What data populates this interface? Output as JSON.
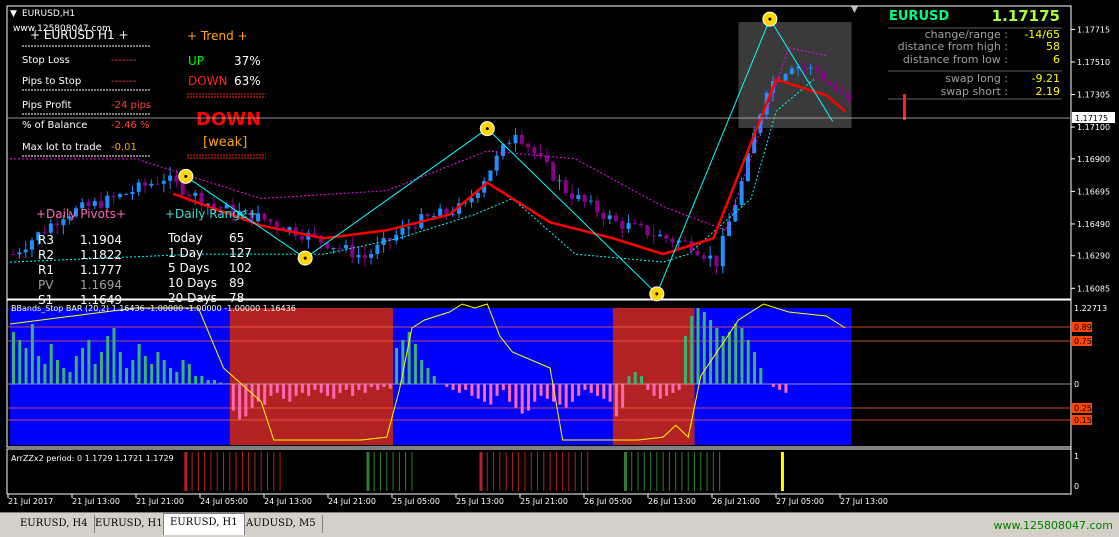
{
  "window": {
    "title": "EURUSD,H1",
    "site": "www.125808047.com"
  },
  "watermark": "www.125808047.com",
  "tabs": [
    {
      "label": "EURUSD, H4",
      "active": false
    },
    {
      "label": "EURUSD, H1",
      "active": false
    },
    {
      "label": "EURUSD, H1",
      "active": true
    },
    {
      "label": "AUDUSD, M5",
      "active": false
    }
  ],
  "info_panel": {
    "header": "+   EURUSD  H1   +",
    "rows": [
      {
        "label": "Stop Loss",
        "value": "-------",
        "color": "#ff4040"
      },
      {
        "label": "Pips to Stop",
        "value": "-------",
        "color": "#ff4040"
      },
      {
        "label": "Pips Profit",
        "value": "-24 pips",
        "color": "#ff4040"
      },
      {
        "label": "% of Balance",
        "value": "-2.46 %",
        "color": "#ff4040"
      },
      {
        "label": "Max lot to trade",
        "value": "-0.01",
        "color": "#ffa500"
      }
    ]
  },
  "trend_panel": {
    "header": "+   Trend   +",
    "up_label": "UP",
    "up_value": "37%",
    "down_label": "DOWN",
    "down_value": "63%",
    "signal": "DOWN",
    "strength": "[weak]"
  },
  "pivots": {
    "header": "+Daily Pivots+",
    "rows": [
      {
        "label": "R3",
        "value": "1.1904"
      },
      {
        "label": "R2",
        "value": "1.1822"
      },
      {
        "label": "R1",
        "value": "1.1777"
      },
      {
        "label": "PV",
        "value": "1.1694"
      },
      {
        "label": "S1",
        "value": "1.1649"
      }
    ]
  },
  "ranges": {
    "header": "+Daily Range+",
    "rows": [
      {
        "label": "Today",
        "value": "65"
      },
      {
        "label": "1 Day",
        "value": "127"
      },
      {
        "label": "5 Days",
        "value": "102"
      },
      {
        "label": "10 Days",
        "value": "89"
      },
      {
        "label": "20 Days",
        "value": "78"
      }
    ]
  },
  "quote_panel": {
    "symbol": "EURUSD",
    "price": "1.17175",
    "rows": [
      {
        "label": "change/range :",
        "value": "-14/65",
        "color": "#ffff00"
      },
      {
        "label": "distance from high :",
        "value": "58",
        "color": "#ffff00"
      },
      {
        "label": "distance from low :",
        "value": "6",
        "color": "#ffff00"
      },
      {
        "label": "swap long :",
        "value": "-9.21",
        "color": "#ffff00"
      },
      {
        "label": "swap short :",
        "value": "2.19",
        "color": "#ffff00"
      }
    ]
  },
  "colors": {
    "background": "#000000",
    "bull": "#1e90ff",
    "bear": "#8b008b",
    "zigzag": "#00ffff",
    "ma": "#ff0000",
    "pivot_dot": "#ffd700",
    "stop_up": "#00ffff",
    "stop_down": "#ff00ff",
    "hist_up": "#3cb371",
    "hist_down": "#ff69b4",
    "bb_blue": "#0000ff",
    "bb_red": "#b22222"
  },
  "chart_data": [
    {
      "type": "candlestick",
      "name": "EURUSD,H1",
      "ylim": [
        1.1603,
        1.1785
      ],
      "yticks": [
        "1.17715",
        "1.17510",
        "1.17305",
        "1.17100",
        "1.16900",
        "1.16695",
        "1.16490",
        "1.16290",
        "1.16085"
      ],
      "current_price": "1.17175",
      "xticks": [
        "21 Jul 2017",
        "21 Jul 13:00",
        "21 Jul 21:00",
        "24 Jul 05:00",
        "24 Jul 13:00",
        "24 Jul 21:00",
        "25 Jul 05:00",
        "25 Jul 13:00",
        "25 Jul 21:00",
        "26 Jul 05:00",
        "26 Jul 13:00",
        "26 Jul 21:00",
        "27 Jul 05:00",
        "27 Jul 13:00"
      ],
      "path_x": [
        0,
        8,
        16,
        24,
        32,
        40,
        48,
        56,
        64,
        72,
        80,
        88,
        96,
        104,
        108,
        112,
        116,
        120,
        124,
        128,
        133
      ],
      "path_y": [
        1.163,
        1.1655,
        1.1665,
        1.1678,
        1.166,
        1.1652,
        1.164,
        1.1628,
        1.165,
        1.166,
        1.1708,
        1.167,
        1.165,
        1.164,
        1.1636,
        1.1625,
        1.1675,
        1.1735,
        1.175,
        1.1745,
        1.1725
      ],
      "zigzag_x": [
        28,
        47,
        76,
        103,
        121,
        131
      ],
      "zigzag_y": [
        1.1679,
        1.16275,
        1.1709,
        1.1605,
        1.1778,
        1.17135
      ],
      "ma_x": [
        26,
        40,
        50,
        60,
        70,
        76,
        86,
        96,
        104,
        112,
        122,
        130,
        133
      ],
      "ma_y": [
        1.1668,
        1.1648,
        1.164,
        1.1645,
        1.1655,
        1.1675,
        1.165,
        1.164,
        1.163,
        1.164,
        1.174,
        1.173,
        1.172
      ],
      "ma_label": "",
      "stop_upper_x": [
        0,
        20,
        40,
        60,
        76,
        90,
        104,
        114,
        124,
        130
      ],
      "stop_upper_y": [
        1.169,
        1.169,
        1.1665,
        1.167,
        1.1695,
        1.169,
        1.166,
        1.1645,
        1.176,
        1.1755
      ],
      "stop_lower_x": [
        0,
        30,
        50,
        62,
        74,
        80,
        90,
        104,
        108,
        118,
        122,
        128
      ],
      "stop_lower_y": [
        1.1625,
        1.163,
        1.163,
        1.164,
        1.1655,
        1.1665,
        1.163,
        1.1625,
        1.163,
        1.1665,
        1.172,
        1.174
      ]
    },
    {
      "type": "bar",
      "name": "BBands_Stop BAR (20,2)",
      "title": "BBands_Stop BAR (20,2) 1.16436 -1.00000 -1.00000 -1.00000 1.16436",
      "ylim": [
        -1.0,
        1.0
      ],
      "yticks": [
        "1.22713",
        "0.89",
        "0.75",
        "0",
        "0.25",
        "0.15"
      ],
      "red_zones": [
        [
          35,
          61
        ],
        [
          96,
          109
        ]
      ],
      "hist_values": [
        0.65,
        0.55,
        0.45,
        0.75,
        0.35,
        0.25,
        0.5,
        0.3,
        0.2,
        0.15,
        0.35,
        0.45,
        0.55,
        0.25,
        0.4,
        0.6,
        0.7,
        0.4,
        0.2,
        0.3,
        0.5,
        0.35,
        0.25,
        0.4,
        0.3,
        0.2,
        0.15,
        0.3,
        0.25,
        0.1,
        0.1,
        0.05,
        0.05,
        0.02,
        0.01,
        -0.45,
        -0.6,
        -0.55,
        -0.4,
        -0.3,
        -0.35,
        -0.2,
        -0.15,
        -0.25,
        -0.3,
        -0.2,
        -0.15,
        -0.2,
        -0.1,
        -0.15,
        -0.2,
        -0.25,
        -0.15,
        -0.1,
        -0.2,
        -0.1,
        -0.15,
        -0.05,
        -0.1,
        -0.05,
        -0.08,
        0.45,
        0.55,
        0.65,
        0.5,
        0.3,
        0.2,
        0.1,
        0.0,
        -0.05,
        -0.1,
        -0.15,
        -0.1,
        -0.2,
        -0.25,
        -0.3,
        -0.35,
        -0.2,
        -0.1,
        -0.3,
        -0.4,
        -0.5,
        -0.45,
        -0.3,
        -0.2,
        -0.25,
        -0.3,
        -0.35,
        -0.4,
        -0.3,
        -0.2,
        -0.1,
        -0.15,
        -0.2,
        -0.25,
        -0.3,
        -0.55,
        -0.4,
        0.1,
        0.15,
        0.1,
        -0.1,
        -0.2,
        -0.25,
        -0.2,
        -0.15,
        -0.1,
        0.6,
        0.85,
        0.95,
        0.9,
        0.8,
        0.7,
        0.6,
        0.65,
        0.75,
        0.7,
        0.55,
        0.4,
        0.2,
        0.0,
        -0.05,
        -0.1,
        -0.15
      ],
      "line_x": [
        0,
        10,
        20,
        30,
        34,
        40,
        42,
        48,
        56,
        60,
        62,
        64,
        66,
        70,
        72,
        74,
        76,
        78,
        80,
        86,
        88,
        92,
        100,
        104,
        106,
        108,
        110,
        116,
        120,
        124,
        130,
        133
      ],
      "line_y": [
        0.75,
        0.85,
        0.95,
        0.95,
        0.2,
        -0.3,
        -0.95,
        -0.95,
        -0.95,
        -0.9,
        -0.1,
        0.7,
        0.8,
        0.9,
        1.0,
        0.95,
        1.0,
        0.6,
        0.4,
        0.2,
        -0.95,
        -0.95,
        -0.95,
        -0.9,
        -0.7,
        -0.9,
        0.1,
        0.8,
        1.0,
        0.9,
        0.85,
        0.7
      ]
    },
    {
      "type": "bar",
      "name": "ArrZZx2",
      "title": "ArrZZx2 period: 0 1.1729 1.1721 1.1729",
      "ylim": [
        0,
        1
      ],
      "yticks": [
        "1",
        "0"
      ],
      "red_range": [
        28,
        43
      ],
      "green_range": [
        57,
        64
      ],
      "red_range2": [
        75,
        92
      ],
      "green_range2": [
        98,
        113
      ],
      "yellow_bar": 123
    }
  ]
}
